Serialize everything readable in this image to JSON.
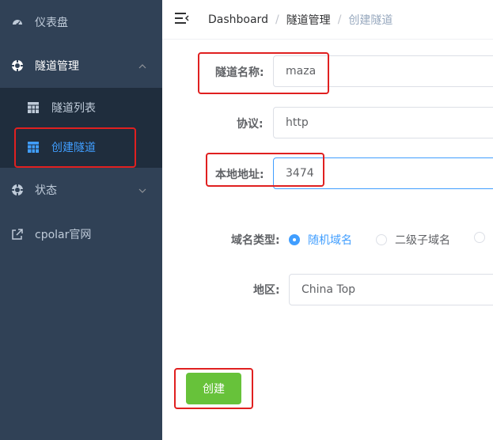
{
  "sidebar": {
    "items": [
      {
        "label": "仪表盘",
        "icon": "dashboard-icon"
      },
      {
        "label": "隧道管理",
        "icon": "tunnel-icon",
        "expanded": true
      },
      {
        "label": "状态",
        "icon": "status-icon"
      },
      {
        "label": "cpolar官网",
        "icon": "external-link-icon"
      }
    ],
    "submenu": [
      {
        "label": "隧道列表",
        "icon": "table-icon"
      },
      {
        "label": "创建隧道",
        "icon": "table-icon",
        "active": true
      }
    ]
  },
  "breadcrumb": [
    "Dashboard",
    "隧道管理",
    "创建隧道"
  ],
  "form": {
    "name_label": "隧道名称:",
    "name_value": "maza",
    "protocol_label": "协议:",
    "protocol_value": "http",
    "local_label": "本地地址:",
    "local_value": "3474",
    "domain_label": "域名类型:",
    "domain_options": [
      "随机域名",
      "二级子域名"
    ],
    "domain_selected": "随机域名",
    "region_label": "地区:",
    "region_value": "China Top"
  },
  "create_button": "创建",
  "colors": {
    "sidebar_bg": "#304156",
    "submenu_bg": "#1f2d3d",
    "accent": "#409eff",
    "success": "#67c23a",
    "highlight": "#e02020"
  }
}
